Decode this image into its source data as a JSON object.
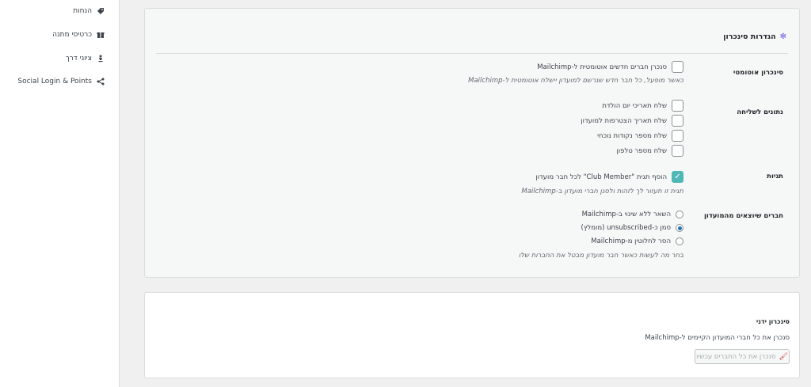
{
  "sidebar": {
    "items": [
      {
        "label": "הנחות",
        "icon": "tag-icon"
      },
      {
        "label": "כרטיסי מתנה",
        "icon": "gift-card-icon"
      },
      {
        "label": "ציוני דרך",
        "icon": "milestone-icon"
      },
      {
        "label": "Social Login & Points",
        "icon": "share-icon"
      }
    ]
  },
  "sync_settings": {
    "title": "הגדרות סינכרון",
    "auto_sync": {
      "label": "סינכרון אוטומטי",
      "option": "סנכרן חברים חדשים אוטומטית ל-Mailchimp",
      "checked": false,
      "hint": "כאשר מופעל, כל חבר חדש שנרשם למועדון יישלח אוטומטית ל-Mailchimp"
    },
    "data_to_send": {
      "label": "נתונים לשליחה",
      "options": [
        {
          "label": "שלח תאריכי יום הולדת",
          "checked": false
        },
        {
          "label": "שלח תאריך הצטרפות למועדון",
          "checked": false
        },
        {
          "label": "שלח מספר נקודות נוכחי",
          "checked": false
        },
        {
          "label": "שלח מספר טלפון",
          "checked": false
        }
      ]
    },
    "tags": {
      "label": "תגיות",
      "option": "הוסף תגית \"Club Member\" לכל חבר מועדון",
      "checked": true,
      "hint": "תגית זו תעזור לך לזהות ולסנן חברי מועדון ב-Mailchimp"
    },
    "leaving_members": {
      "label": "חברים שיוצאים מהמועדון",
      "options": [
        {
          "label": "השאר ללא שינוי ב-Mailchimp",
          "selected": false
        },
        {
          "label": "סמן כ-unsubscribed (מומלץ)",
          "selected": true
        },
        {
          "label": "הסר לחלוטין מ-Mailchimp",
          "selected": false
        }
      ],
      "hint": "בחר מה לעשות כאשר חבר מועדון מבטל את החברות שלו"
    }
  },
  "manual_sync": {
    "title": "סינכרון ידני",
    "description": "סנכרן את כל חברי המועדון הקיימים ל-Mailchimp",
    "button_label": "סנכרן את כל החברים עכשיו"
  },
  "colors": {
    "accent": "#4fb7b5",
    "radio": "#2271b1"
  }
}
